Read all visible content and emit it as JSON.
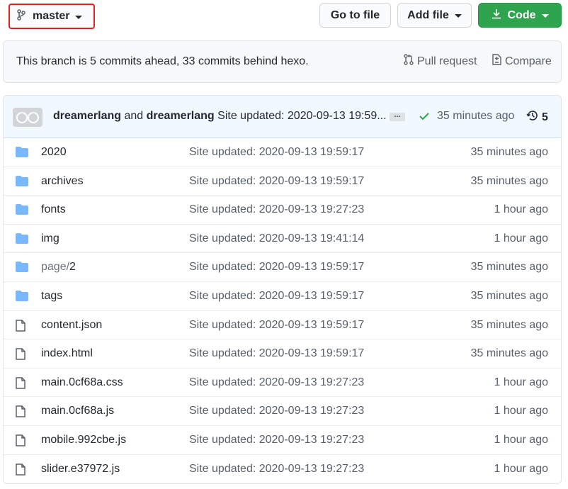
{
  "toolbar": {
    "branch": "master",
    "goto_file": "Go to file",
    "add_file": "Add file",
    "code": "Code"
  },
  "branch_info": {
    "message": "This branch is 5 commits ahead, 33 commits behind hexo.",
    "pull_request": "Pull request",
    "compare": "Compare"
  },
  "commit": {
    "author1": "dreamerlang",
    "and": "and",
    "author2": "dreamerlang",
    "message": "Site updated: 2020-09-13 19:59...",
    "ellipsis": "...",
    "time": "35 minutes ago",
    "history_count": "5"
  },
  "files": [
    {
      "type": "folder",
      "name": "2020",
      "message": "Site updated: 2020-09-13 19:59:17",
      "age": "35 minutes ago"
    },
    {
      "type": "folder",
      "name": "archives",
      "message": "Site updated: 2020-09-13 19:59:17",
      "age": "35 minutes ago"
    },
    {
      "type": "folder",
      "name": "fonts",
      "message": "Site updated: 2020-09-13 19:27:23",
      "age": "1 hour ago"
    },
    {
      "type": "folder",
      "name": "img",
      "message": "Site updated: 2020-09-13 19:41:14",
      "age": "1 hour ago"
    },
    {
      "type": "folder",
      "name_prefix": "page/",
      "name": "2",
      "message": "Site updated: 2020-09-13 19:59:17",
      "age": "35 minutes ago"
    },
    {
      "type": "folder",
      "name": "tags",
      "message": "Site updated: 2020-09-13 19:59:17",
      "age": "35 minutes ago"
    },
    {
      "type": "file",
      "name": "content.json",
      "message": "Site updated: 2020-09-13 19:59:17",
      "age": "35 minutes ago"
    },
    {
      "type": "file",
      "name": "index.html",
      "message": "Site updated: 2020-09-13 19:59:17",
      "age": "35 minutes ago"
    },
    {
      "type": "file",
      "name": "main.0cf68a.css",
      "message": "Site updated: 2020-09-13 19:27:23",
      "age": "1 hour ago"
    },
    {
      "type": "file",
      "name": "main.0cf68a.js",
      "message": "Site updated: 2020-09-13 19:27:23",
      "age": "1 hour ago"
    },
    {
      "type": "file",
      "name": "mobile.992cbe.js",
      "message": "Site updated: 2020-09-13 19:27:23",
      "age": "1 hour ago"
    },
    {
      "type": "file",
      "name": "slider.e37972.js",
      "message": "Site updated: 2020-09-13 19:27:23",
      "age": "1 hour ago"
    }
  ],
  "colors": {
    "folder": "#79b8ff",
    "code_button": "#2ea44f",
    "highlight_border": "#e02020",
    "commit_row_bg": "#f1f8ff"
  }
}
